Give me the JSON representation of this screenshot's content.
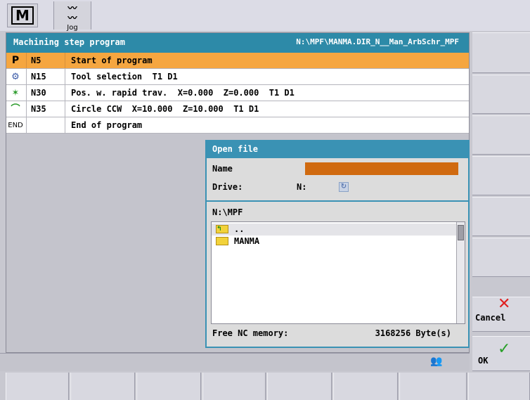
{
  "topbar": {
    "mode_m_label": "M",
    "jog_icon": "jog-wave-icon",
    "jog_label": "Jog"
  },
  "program": {
    "title": "Machining step program",
    "path": "N:\\MPF\\MANMA.DIR_N__Man_ArbSchr_MPF",
    "rows": [
      {
        "icon": "P",
        "block": "N5",
        "text": "Start of program",
        "selected": true
      },
      {
        "icon": "tool-icon",
        "block": "N15",
        "text": "Tool selection  T1 D1",
        "selected": false
      },
      {
        "icon": "rapid-traverse-icon",
        "block": "N30",
        "text": "Pos. w. rapid trav.  X=0.000  Z=0.000  T1 D1",
        "selected": false
      },
      {
        "icon": "circle-ccw-icon",
        "block": "N35",
        "text": "Circle CCW  X=10.000  Z=10.000  T1 D1",
        "selected": false
      },
      {
        "icon": "END",
        "block": "",
        "text": "End of program",
        "selected": false
      }
    ]
  },
  "dialog": {
    "title": "Open file",
    "name_label": "Name",
    "name_value": "",
    "drive_label": "Drive:",
    "drive_value": "N:",
    "current_path": "N:\\MPF",
    "files": [
      {
        "name": "..",
        "type": "parent-folder"
      },
      {
        "name": "MANMA",
        "type": "folder"
      }
    ],
    "memory_label": "Free NC memory:",
    "memory_value": "3168256 Byte(s)"
  },
  "softkeys": {
    "cancel_label": "Cancel",
    "ok_label": "OK"
  },
  "colors": {
    "title_bar": "#2d8aa8",
    "selection": "#f5a640",
    "name_input": "#d06a10"
  }
}
